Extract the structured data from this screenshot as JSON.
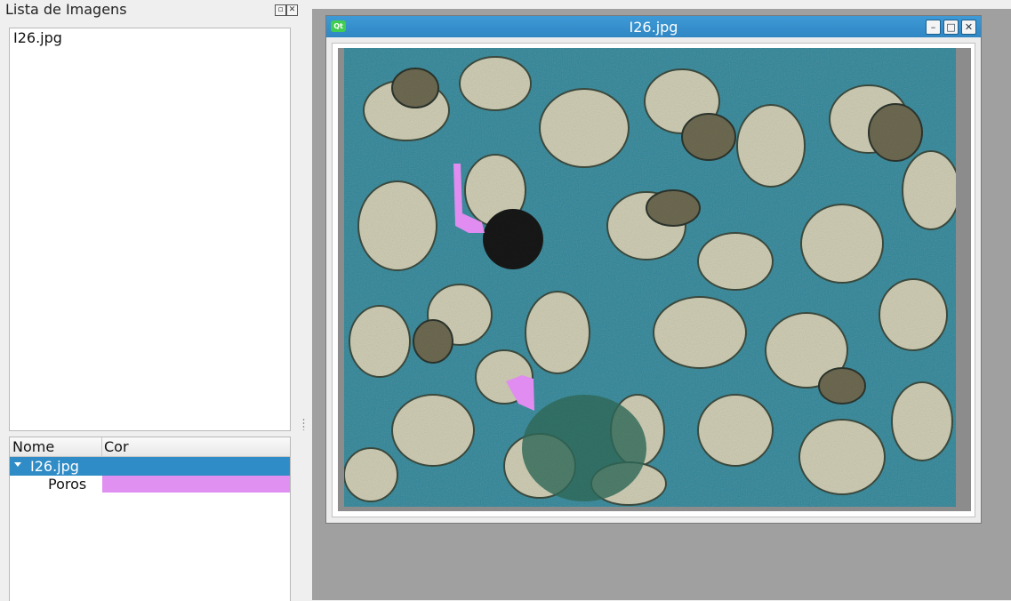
{
  "dock": {
    "title": "Lista de Imagens",
    "image_list": [
      "I26.jpg"
    ]
  },
  "tree": {
    "columns": [
      "Nome",
      "Cor"
    ],
    "image_item": "I26.jpg",
    "class_item": "Poros",
    "class_color": "#e090f0"
  },
  "subwindow": {
    "title": "I26.jpg"
  },
  "colors": {
    "accent": "#308cc6",
    "annotation": "#e08cf0",
    "mdi_background": "#a0a0a0"
  }
}
